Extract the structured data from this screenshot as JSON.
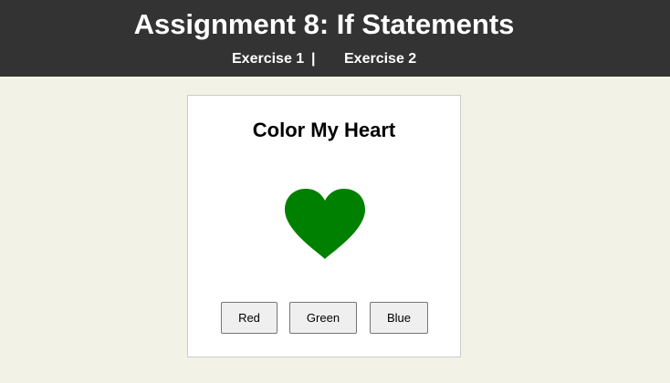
{
  "header": {
    "title": "Assignment 8: If Statements",
    "nav": {
      "exercise1": "Exercise 1",
      "separator": "|",
      "exercise2": "Exercise 2"
    }
  },
  "card": {
    "title": "Color My Heart",
    "heart_color": "#008000",
    "buttons": {
      "red": "Red",
      "green": "Green",
      "blue": "Blue"
    }
  },
  "colors": {
    "header_bg": "#333333",
    "page_bg": "#f2f2e6",
    "card_bg": "#ffffff"
  }
}
